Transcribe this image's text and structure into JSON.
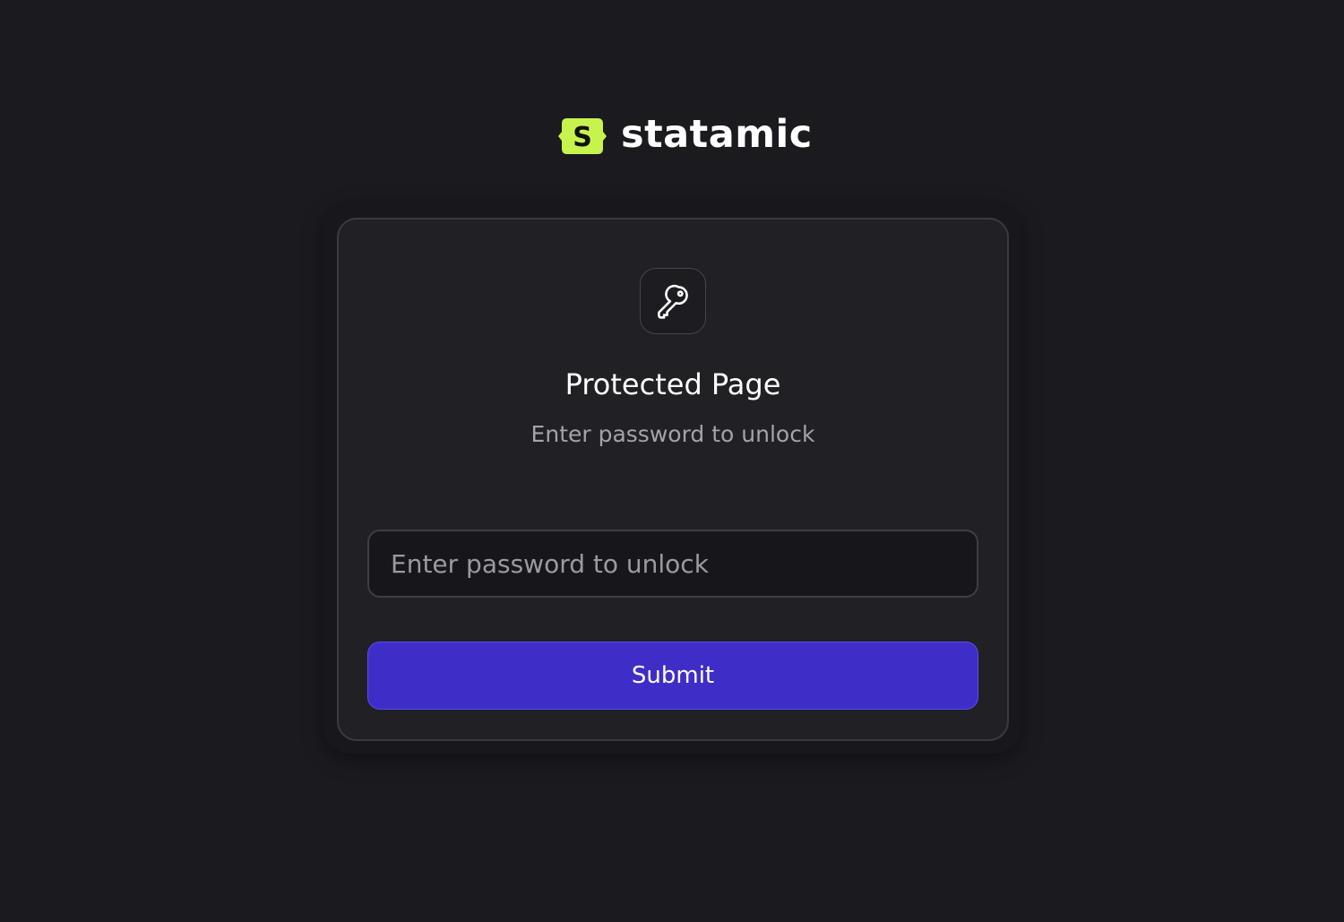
{
  "brand": {
    "name": "statamic",
    "logo_letter": "S",
    "logo_color": "#c6f44d"
  },
  "card": {
    "icon": "key-icon",
    "title": "Protected Page",
    "subtitle": "Enter password to unlock"
  },
  "form": {
    "password_placeholder": "Enter password to unlock",
    "password_value": "",
    "submit_label": "Submit",
    "submit_color": "#3f2dc8"
  },
  "theme": {
    "background": "#1a1a1f",
    "card_background": "#202025"
  }
}
